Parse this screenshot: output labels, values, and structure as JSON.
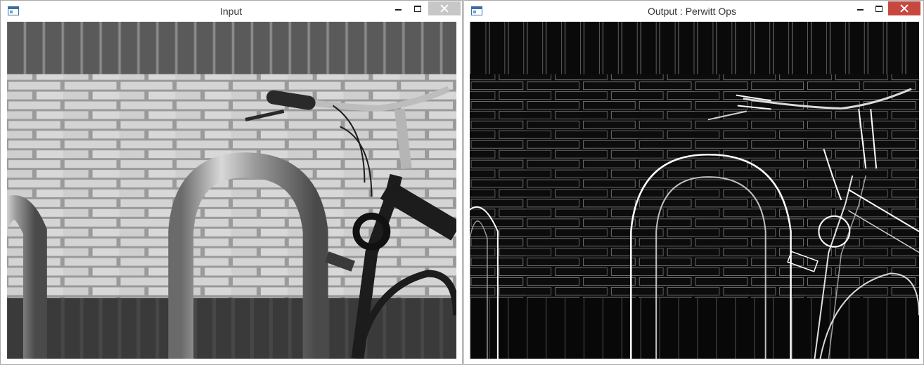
{
  "windows": {
    "input": {
      "title": "Input",
      "icon": "opencv-window-icon",
      "image": "grayscale-photo-bike-rack-brick-wall"
    },
    "output": {
      "title": "Output : Perwitt Ops",
      "icon": "opencv-window-icon",
      "image": "edge-detection-result-bike-rack-brick-wall"
    }
  },
  "colors": {
    "close_inactive": "#c7c7c7",
    "close_active": "#c7483f",
    "window_border": "#a9a9a9"
  }
}
